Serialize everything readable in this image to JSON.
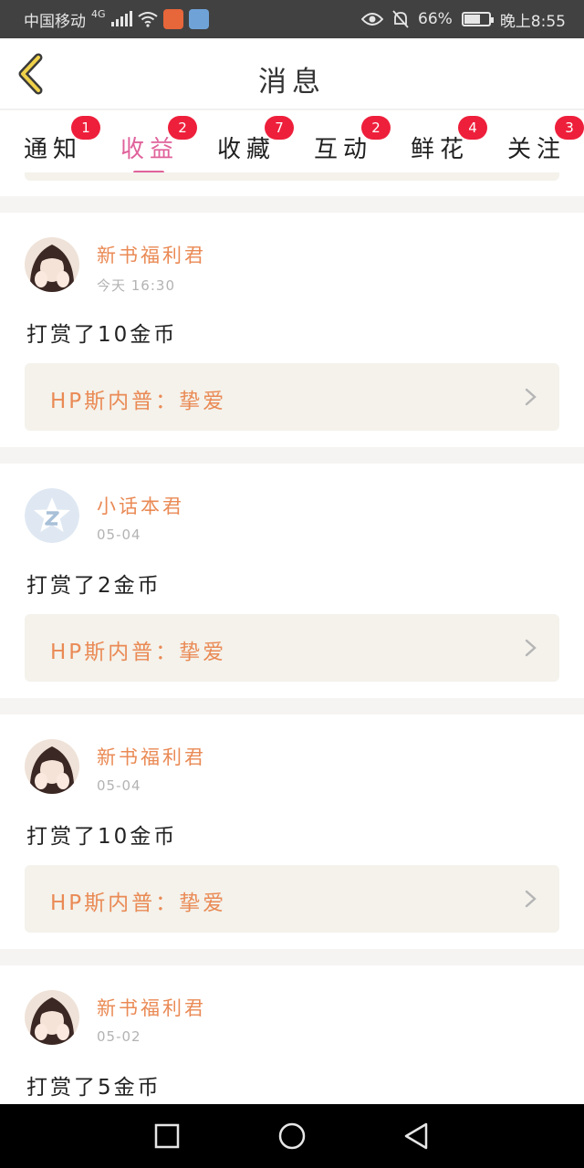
{
  "status_bar": {
    "carrier": "中国移动",
    "network": "4G",
    "battery": "66%",
    "battery_level": 0.66,
    "time": "晚上8:55"
  },
  "header": {
    "title": "消息"
  },
  "tabs": [
    {
      "label": "通知",
      "badge": "1",
      "active": false
    },
    {
      "label": "收益",
      "badge": "2",
      "active": true
    },
    {
      "label": "收藏",
      "badge": "7",
      "active": false
    },
    {
      "label": "互动",
      "badge": "2",
      "active": false
    },
    {
      "label": "鲜花",
      "badge": "4",
      "active": false
    },
    {
      "label": "关注",
      "badge": "3",
      "active": false
    }
  ],
  "messages": [
    {
      "user": "新书福利君",
      "time": "今天 16:30",
      "text": "打赏了10金币",
      "book": "HP斯内普：挚爱",
      "avatar": "girl-photo"
    },
    {
      "user": "小话本君",
      "time": "05-04",
      "text": "打赏了2金币",
      "book": "HP斯内普：挚爱",
      "avatar": "z-star-logo"
    },
    {
      "user": "新书福利君",
      "time": "05-04",
      "text": "打赏了10金币",
      "book": "HP斯内普：挚爱",
      "avatar": "girl-photo"
    },
    {
      "user": "新书福利君",
      "time": "05-02",
      "text": "打赏了5金币",
      "avatar": "girl-photo"
    }
  ],
  "colors": {
    "accent": "#e0629b",
    "name": "#ea8a55",
    "badge": "#ee1f3b",
    "book_bg": "#f4f2eb"
  }
}
